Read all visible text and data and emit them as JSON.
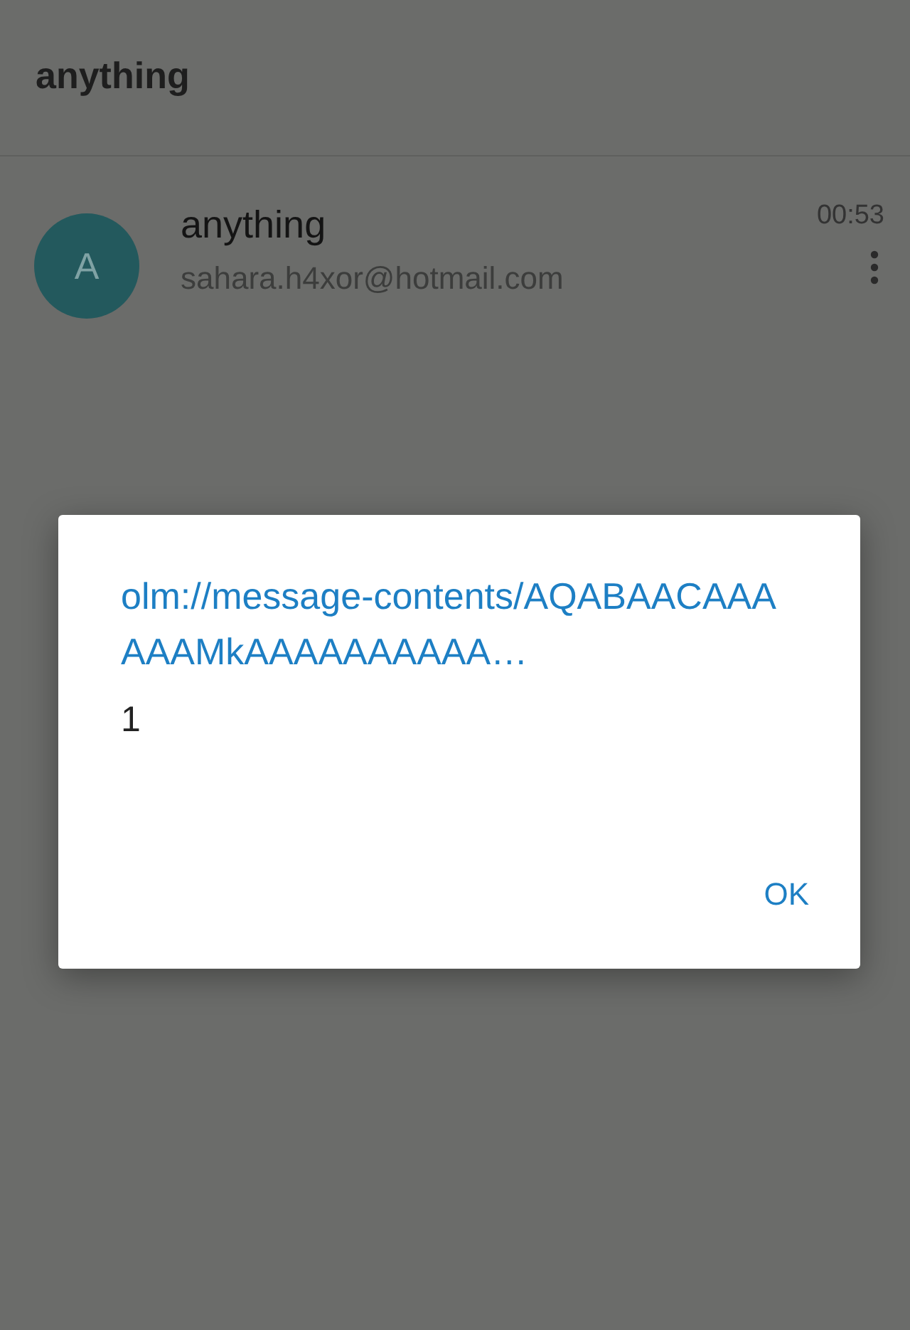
{
  "app_bar": {
    "title": "anything"
  },
  "messages": [
    {
      "avatar": "A",
      "sender": "anything",
      "address": "sahara.h4xor@hotmail.com",
      "time": "00:53"
    }
  ],
  "dialog": {
    "title": "olm://message-contents/AQABAACAAAAAAMkAAAAAAAAAA…",
    "message": "1",
    "buttons": [
      "OK"
    ]
  }
}
